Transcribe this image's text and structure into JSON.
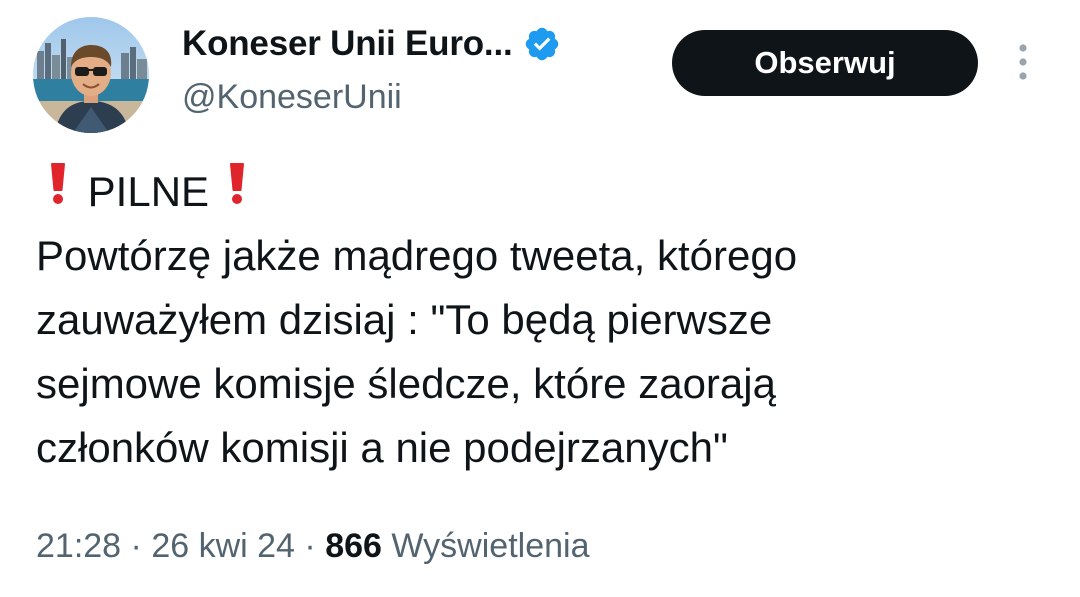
{
  "author": {
    "display_name": "Koneser Unii Euro...",
    "handle": "@KoneserUnii",
    "verified": true,
    "verified_color": "#1d9bf0"
  },
  "actions": {
    "follow_label": "Obserwuj"
  },
  "tweet": {
    "headline": "PILNE",
    "body_lines": [
      "Powtórzę jakże mądrego tweeta, którego",
      "zauważyłem dzisiaj : \"To będą pierwsze",
      "sejmowe komisje śledcze, które zaorają",
      "członków komisji a nie podejrzanych\""
    ],
    "emoji": "red-exclamation-icon"
  },
  "meta": {
    "time": "21:28",
    "separator": "·",
    "date": "26 kwi 24",
    "views_count": "866",
    "views_label": "Wyświetlenia"
  }
}
